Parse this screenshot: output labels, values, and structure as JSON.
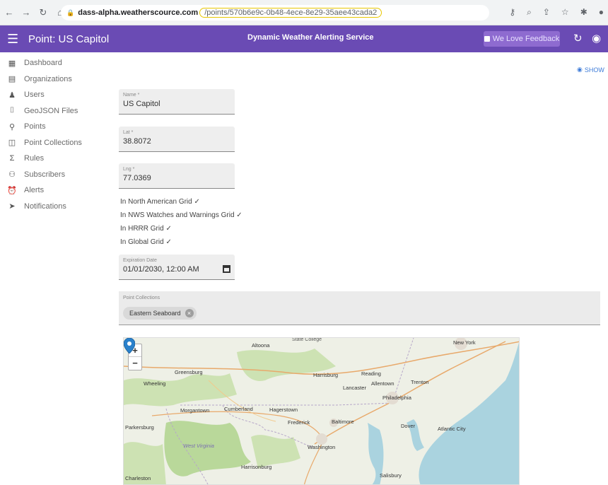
{
  "browser": {
    "host": "dass-alpha.weatherscource.com",
    "path": "/points/570b6e9c-0b48-4ece-8e29-35aee43cada2"
  },
  "appbar": {
    "page_title": "Point: US Capitol",
    "service_name": "Dynamic Weather Alerting Service",
    "feedback_label": "We Love Feedback"
  },
  "sidebar": {
    "items": [
      {
        "label": "Dashboard",
        "icon": "dashboard-icon"
      },
      {
        "label": "Organizations",
        "icon": "organization-icon"
      },
      {
        "label": "Users",
        "icon": "user-icon"
      },
      {
        "label": "GeoJSON Files",
        "icon": "file-icon"
      },
      {
        "label": "Points",
        "icon": "pin-icon"
      },
      {
        "label": "Point Collections",
        "icon": "collection-icon"
      },
      {
        "label": "Rules",
        "icon": "sigma-icon"
      },
      {
        "label": "Subscribers",
        "icon": "group-icon"
      },
      {
        "label": "Alerts",
        "icon": "alarm-icon"
      },
      {
        "label": "Notifications",
        "icon": "send-icon"
      }
    ]
  },
  "show_label": "SHOW",
  "form": {
    "name": {
      "label": "Name *",
      "value": "US Capitol"
    },
    "lat": {
      "label": "Lat *",
      "value": "38.8072"
    },
    "lng": {
      "label": "Lng *",
      "value": "77.0369"
    },
    "grids": [
      "In North American Grid ✓",
      "In NWS Watches and Warnings Grid ✓",
      "In HRRR Grid ✓",
      "In Global Grid ✓"
    ],
    "expiration": {
      "label": "Expiration Date",
      "value": "01/01/2030, 12:00 AM"
    },
    "collections": {
      "label": "Point Collections",
      "chip": "Eastern Seaboard"
    }
  },
  "map": {
    "zoom_in": "+",
    "zoom_out": "−",
    "labels": {
      "altoona": "Altoona",
      "state_college": "State College",
      "harrisburg": "Harrisburg",
      "reading": "Reading",
      "lancaster": "Lancaster",
      "philadelphia": "Philadelphia",
      "new_york": "New York",
      "trenton": "Trenton",
      "greensburg": "Greensburg",
      "cumberland": "Cumberland",
      "hagerstown": "Hagerstown",
      "frederick": "Frederick",
      "baltimore": "Baltimore",
      "washington": "Washington",
      "west_virginia": "West Virginia",
      "parkersburg": "Parkersburg",
      "harrisonburg": "Harrisonburg",
      "charleston": "Charleston",
      "dover": "Dover",
      "atlantic_city": "Atlantic City",
      "salisbury": "Salisbury",
      "wheeling": "Wheeling",
      "morgantown": "Morgantown",
      "allentown": "Allentown"
    }
  }
}
